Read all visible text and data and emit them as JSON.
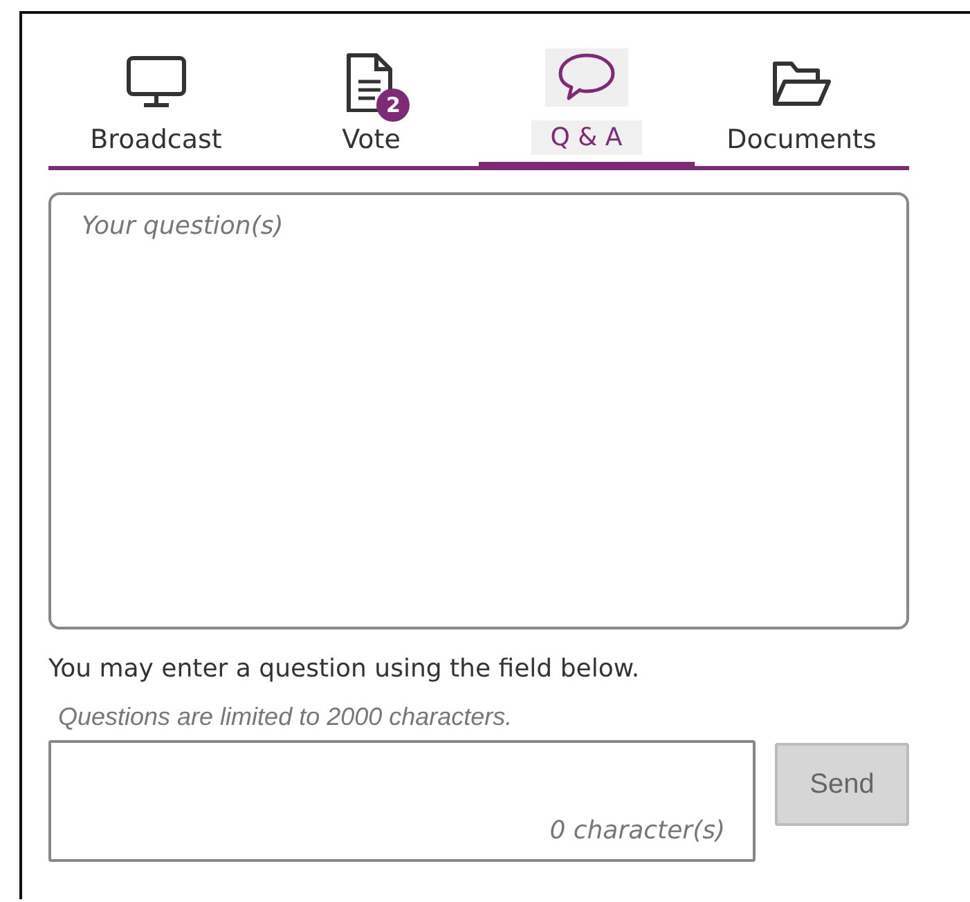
{
  "tabs": [
    {
      "label": "Broadcast",
      "kind": "monitor",
      "selected": false
    },
    {
      "label": "Vote",
      "kind": "document",
      "badge": "2",
      "selected": false
    },
    {
      "label": "Q & A",
      "kind": "chat",
      "selected": true
    },
    {
      "label": "Documents",
      "kind": "folder",
      "selected": false
    }
  ],
  "questions_box": {
    "placeholder": "Your question(s)"
  },
  "instruction": "You may enter a question using the field below.",
  "limit_hint": "Questions are limited to 2000 characters.",
  "question_field": {
    "counter": "0 character(s)"
  },
  "send_button": {
    "label": "Send",
    "disabled": true
  }
}
